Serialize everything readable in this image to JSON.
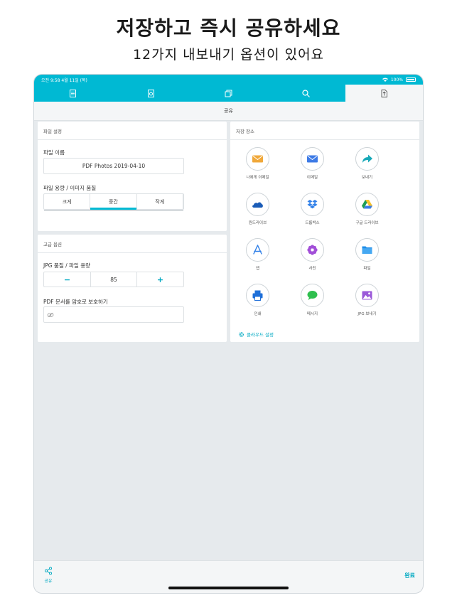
{
  "promo": {
    "headline": "저장하고 즉시 공유하세요",
    "subline": "12가지 내보내기 옵션이 있어요"
  },
  "statusbar": {
    "time_date": "오전 9:58   4월 11일 (목)",
    "battery_text": "100%"
  },
  "tabs": [
    {
      "icon": "document-icon",
      "active": false
    },
    {
      "icon": "document-settings-icon",
      "active": false
    },
    {
      "icon": "pages-icon",
      "active": false
    },
    {
      "icon": "search-icon",
      "active": false
    },
    {
      "icon": "export-icon",
      "active": true
    }
  ],
  "toolbar": {
    "title": "공유"
  },
  "file_settings": {
    "header": "파일 설정",
    "name_label": "파일 이름",
    "name_value": "PDF Photos 2019-04-10",
    "quality_label": "파일 용량 / 이미지 품질",
    "quality_options": [
      "크게",
      "중간",
      "작게"
    ],
    "quality_selected": "중간"
  },
  "advanced": {
    "header": "고급 옵션",
    "jpg_label": "JPG 품질 / 파일 용량",
    "jpg_minus": "−",
    "jpg_value": "85",
    "jpg_plus": "+",
    "password_label": "PDF 문서를 암호로 보호하기"
  },
  "storage": {
    "header": "저장 장소",
    "items": [
      {
        "label": "나에게 이메일",
        "icon": "mail-orange-icon"
      },
      {
        "label": "이메일",
        "icon": "mail-blue-icon"
      },
      {
        "label": "보내기",
        "icon": "share-arrow-icon"
      },
      {
        "label": "원드라이브",
        "icon": "onedrive-icon"
      },
      {
        "label": "드롭박스",
        "icon": "dropbox-icon"
      },
      {
        "label": "구글 드라이브",
        "icon": "google-drive-icon"
      },
      {
        "label": "앱",
        "icon": "app-store-icon"
      },
      {
        "label": "사진",
        "icon": "photos-icon"
      },
      {
        "label": "파일",
        "icon": "files-folder-icon"
      },
      {
        "label": "인쇄",
        "icon": "printer-icon"
      },
      {
        "label": "메시지",
        "icon": "messages-icon"
      },
      {
        "label": "JPG 보내기",
        "icon": "image-icon"
      }
    ],
    "cloud_settings": "클라우드 설정"
  },
  "bottombar": {
    "share_label": "공유",
    "done_label": "완료"
  },
  "colors": {
    "accent": "#00b9d3",
    "accent_text": "#00a9c2"
  }
}
